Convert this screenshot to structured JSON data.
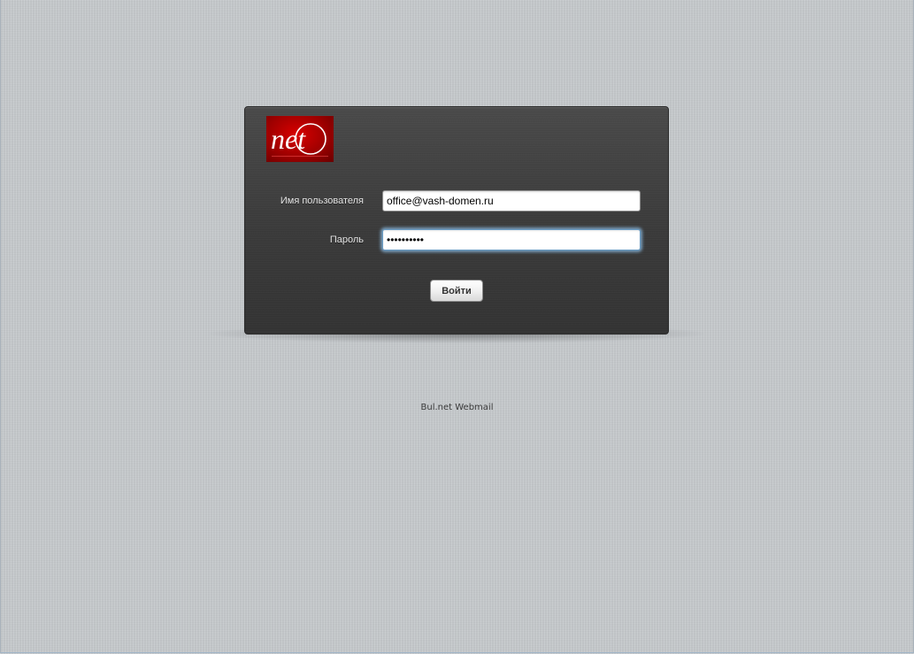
{
  "login": {
    "logo_text": "net",
    "username_label": "Имя пользователя",
    "username_value": "office@vash-domen.ru",
    "password_label": "Пароль",
    "password_value": "••••••••••",
    "submit_label": "Войти"
  },
  "footer": {
    "text": "Bul.net Webmail"
  },
  "colors": {
    "page_background": "#c6cacd",
    "panel_background": "#3d3d3d",
    "logo_red": "#c00000",
    "focus_glow": "#8cbee6"
  },
  "icons": {
    "logo": "net-brand-logo"
  }
}
